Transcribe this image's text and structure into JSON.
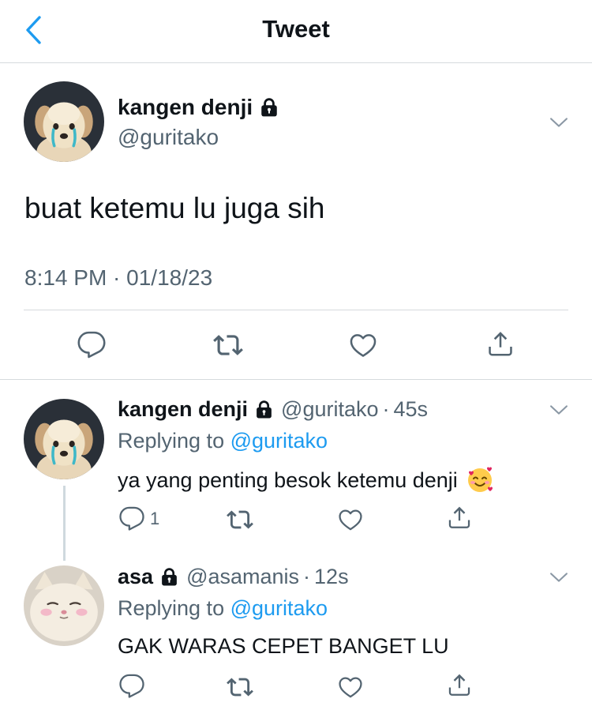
{
  "header": {
    "title": "Tweet"
  },
  "main_tweet": {
    "name": "kangen denji",
    "handle": "@guritako",
    "text": "buat ketemu lu juga sih",
    "timestamp": "8:14 PM · 01/18/23"
  },
  "replies": [
    {
      "name": "kangen denji",
      "handle": "@guritako",
      "dot": "·",
      "age": "45s",
      "replying_prefix": "Replying to",
      "replying_to": "@guritako",
      "text": "ya yang penting besok ketemu denji",
      "emoji": "🥰",
      "reply_count": "1"
    },
    {
      "name": "asa",
      "handle": "@asamanis",
      "dot": "·",
      "age": "12s",
      "replying_prefix": "Replying to",
      "replying_to": "@guritako",
      "text": "GAK WARAS CEPET BANGET LU",
      "reply_count": ""
    }
  ],
  "colors": {
    "accent": "#1d9bf0",
    "secondary_text": "#536471",
    "divider": "#d6dadd"
  },
  "icons": [
    "chevron-left-icon",
    "lock-icon",
    "chevron-down-icon",
    "reply-icon",
    "retweet-icon",
    "like-icon",
    "share-icon"
  ]
}
